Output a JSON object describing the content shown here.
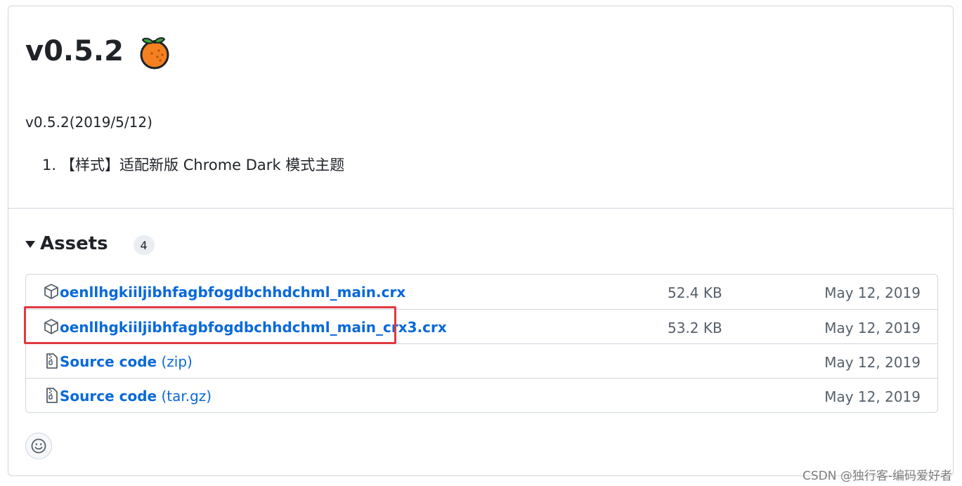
{
  "release": {
    "title": "v0.5.2",
    "date_line": "v0.5.2(2019/5/12)",
    "notes": [
      {
        "number": "1.",
        "text": "【样式】适配新版 Chrome Dark 模式主题"
      }
    ]
  },
  "assets": {
    "title": "Assets",
    "count": "4",
    "rows": [
      {
        "icon": "package-icon",
        "name": "oenllhgkiiljibhfagbfogdbchhdchml_main.crx",
        "suffix": "",
        "size": "52.4 KB",
        "date": "May 12, 2019"
      },
      {
        "icon": "package-icon",
        "name": "oenllhgkiiljibhfagbfogdbchhdchml_main_crx3.crx",
        "suffix": "",
        "size": "53.2 KB",
        "date": "May 12, 2019"
      },
      {
        "icon": "file-zip-icon",
        "name": "Source code",
        "suffix": " (zip)",
        "size": "",
        "date": "May 12, 2019"
      },
      {
        "icon": "file-zip-icon",
        "name": "Source code",
        "suffix": " (tar.gz)",
        "size": "",
        "date": "May 12, 2019"
      }
    ]
  },
  "watermark": "CSDN @独行客-编码爱好者",
  "colors": {
    "link": "#0969da",
    "highlight": "#e0393e",
    "muted": "#57606a",
    "border": "#d0d7de"
  }
}
